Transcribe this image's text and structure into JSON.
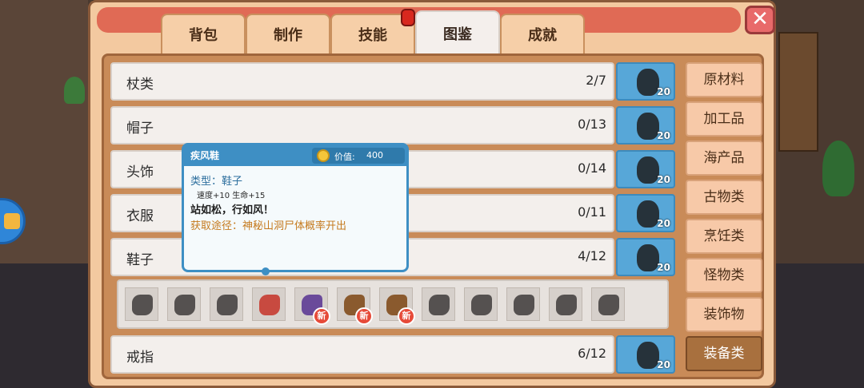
{
  "tabs": [
    {
      "label": "背包"
    },
    {
      "label": "制作"
    },
    {
      "label": "技能"
    },
    {
      "label": "图鉴"
    },
    {
      "label": "成就"
    }
  ],
  "active_tab": "图鉴",
  "close_label": "✕",
  "rows": [
    {
      "name": "杖类",
      "count": "2/7",
      "slot_num": "20"
    },
    {
      "name": "帽子",
      "count": "0/13",
      "slot_num": "20"
    },
    {
      "name": "头饰",
      "count": "0/14",
      "slot_num": "20"
    },
    {
      "name": "衣服",
      "count": "0/11",
      "slot_num": "20"
    },
    {
      "name": "鞋子",
      "count": "4/12",
      "slot_num": "20"
    },
    {
      "name": "戒指",
      "count": "6/12",
      "slot_num": "20"
    }
  ],
  "item_badge": "新",
  "categories": [
    {
      "label": "原材料"
    },
    {
      "label": "加工品"
    },
    {
      "label": "海产品"
    },
    {
      "label": "古物类"
    },
    {
      "label": "烹饪类"
    },
    {
      "label": "怪物类"
    },
    {
      "label": "装饰物"
    },
    {
      "label": "装备类"
    }
  ],
  "active_category": "装备类",
  "tooltip": {
    "name": "疾风鞋",
    "price_label": "价值:",
    "price": "400",
    "type": "类型：鞋子",
    "stats": "速度+10   生命+15",
    "desc": "站如松，行如风！",
    "source": "获取途径：神秘山洞尸体概率开出"
  },
  "colors": {
    "panel": "#f3c9a0",
    "tab_active": "#f4efec",
    "slot_blue": "#57a7d8",
    "category_active": "#a8703e",
    "tooltip_border": "#3e8fc4",
    "badge_red": "#e64a38"
  }
}
